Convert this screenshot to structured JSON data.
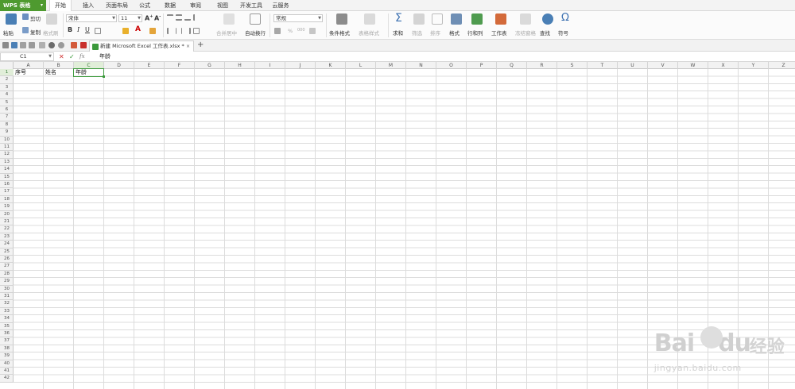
{
  "app": {
    "name": "WPS 表格",
    "arrow": "▾"
  },
  "menu_tabs": [
    "开始",
    "插入",
    "页面布局",
    "公式",
    "数据",
    "审阅",
    "视图",
    "开发工具",
    "云服务"
  ],
  "active_tab": "开始",
  "ribbon": {
    "paste": "粘贴",
    "cut": "剪切",
    "copy": "复制",
    "format_painter": "格式刷",
    "font_name": "宋体",
    "font_size": "11",
    "bold": "B",
    "italic": "I",
    "underline": "U",
    "merge_center": "合并居中",
    "wrap_text": "自动换行",
    "number_format": "常规",
    "percent": "%",
    "comma": "000",
    "cond_format": "条件格式",
    "table_style": "表格样式",
    "sum": "求和",
    "filter": "筛选",
    "sort": "排序",
    "format": "格式",
    "row_col": "行和列",
    "worksheet": "工作表",
    "freeze": "冻结窗格",
    "find": "查找",
    "symbol": "符号"
  },
  "document_tab": {
    "title": "新建 Microsoft Excel 工作表.xlsx *",
    "close": "×",
    "new_tab": "+"
  },
  "formula_bar": {
    "name_box": "C1",
    "cancel": "✕",
    "confirm": "✓",
    "fx": "fx",
    "value": "年龄"
  },
  "columns": [
    "A",
    "B",
    "C",
    "D",
    "E",
    "F",
    "G",
    "H",
    "I",
    "J",
    "K",
    "L",
    "M",
    "N",
    "O",
    "P",
    "Q",
    "R",
    "S",
    "T",
    "U",
    "V",
    "W",
    "X",
    "Y",
    "Z"
  ],
  "rows": [
    "1",
    "2",
    "3",
    "4",
    "5",
    "6",
    "7",
    "8",
    "9",
    "10",
    "11",
    "12",
    "13",
    "14",
    "15",
    "16",
    "17",
    "18",
    "19",
    "20",
    "21",
    "22",
    "23",
    "24",
    "25",
    "26",
    "27",
    "28",
    "29",
    "30",
    "31",
    "32",
    "33",
    "34",
    "35",
    "36",
    "37",
    "38",
    "39",
    "40",
    "41",
    "42"
  ],
  "cells": [
    {
      "ref": "A1",
      "value": "序号"
    },
    {
      "ref": "B1",
      "value": "姓名"
    },
    {
      "ref": "C1",
      "value": "年龄"
    }
  ],
  "selected_cell": "C1",
  "watermark": {
    "brand": "Bai",
    "brand2": "du",
    "cn": "经验",
    "site": "jingyan.baidu.com"
  },
  "colors": {
    "accent": "#4e9a2f",
    "selection": "#3c9a3c"
  }
}
